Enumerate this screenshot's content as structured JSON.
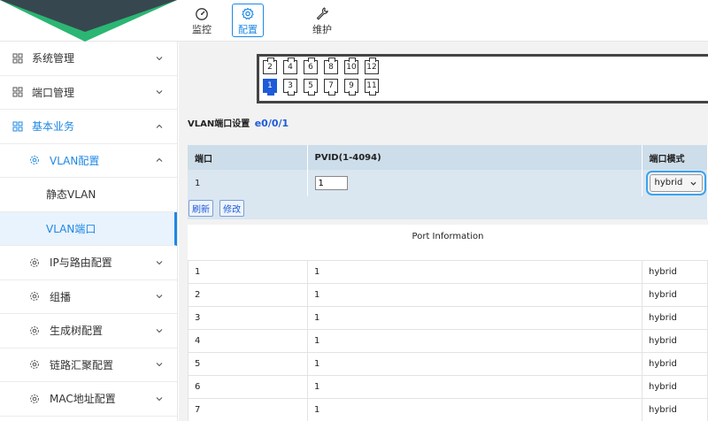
{
  "topnav": {
    "items": [
      {
        "label": "监控",
        "icon": "dashboard-icon"
      },
      {
        "label": "配置",
        "icon": "gear-icon",
        "active": true
      },
      {
        "label": "维护",
        "icon": "wrench-icon"
      }
    ]
  },
  "sidebar": {
    "items": [
      {
        "label": "系统管理",
        "icon": "grid-icon"
      },
      {
        "label": "端口管理",
        "icon": "grid-icon"
      },
      {
        "label": "基本业务",
        "icon": "grid-icon",
        "open": true
      },
      {
        "label": "VLAN配置",
        "icon": "gear-icon",
        "open": true
      },
      {
        "label": "静态VLAN"
      },
      {
        "label": "VLAN端口",
        "selected": true
      },
      {
        "label": "IP与路由配置",
        "icon": "gear-icon"
      },
      {
        "label": "组播",
        "icon": "gear-icon"
      },
      {
        "label": "生成树配置",
        "icon": "gear-icon"
      },
      {
        "label": "链路汇聚配置",
        "icon": "gear-icon"
      },
      {
        "label": "MAC地址配置",
        "icon": "gear-icon"
      }
    ]
  },
  "ports": {
    "top": [
      "2",
      "4",
      "6",
      "8",
      "10",
      "12"
    ],
    "bottom": [
      "1",
      "3",
      "5",
      "7",
      "9",
      "11"
    ],
    "active": "1"
  },
  "section": {
    "title": "VLAN端口设置",
    "port_id": "e0/0/1"
  },
  "config_table": {
    "headers": [
      "端口",
      "PVID(1-4094)",
      "端口模式"
    ],
    "row": {
      "port": "1",
      "pvid": "1",
      "mode": "hybrid"
    },
    "buttons": {
      "refresh": "刷新",
      "modify": "修改"
    }
  },
  "info": {
    "title": "Port Information",
    "rows": [
      [
        "1",
        "1",
        "hybrid"
      ],
      [
        "2",
        "1",
        "hybrid"
      ],
      [
        "3",
        "1",
        "hybrid"
      ],
      [
        "4",
        "1",
        "hybrid"
      ],
      [
        "5",
        "1",
        "hybrid"
      ],
      [
        "6",
        "1",
        "hybrid"
      ],
      [
        "7",
        "1",
        "hybrid"
      ]
    ]
  },
  "colors": {
    "accent": "#1e88e5",
    "logo_green": "#2bb673",
    "logo_dark": "#37474f",
    "table_header": "#cdddea",
    "table_row": "#dae6f0"
  }
}
